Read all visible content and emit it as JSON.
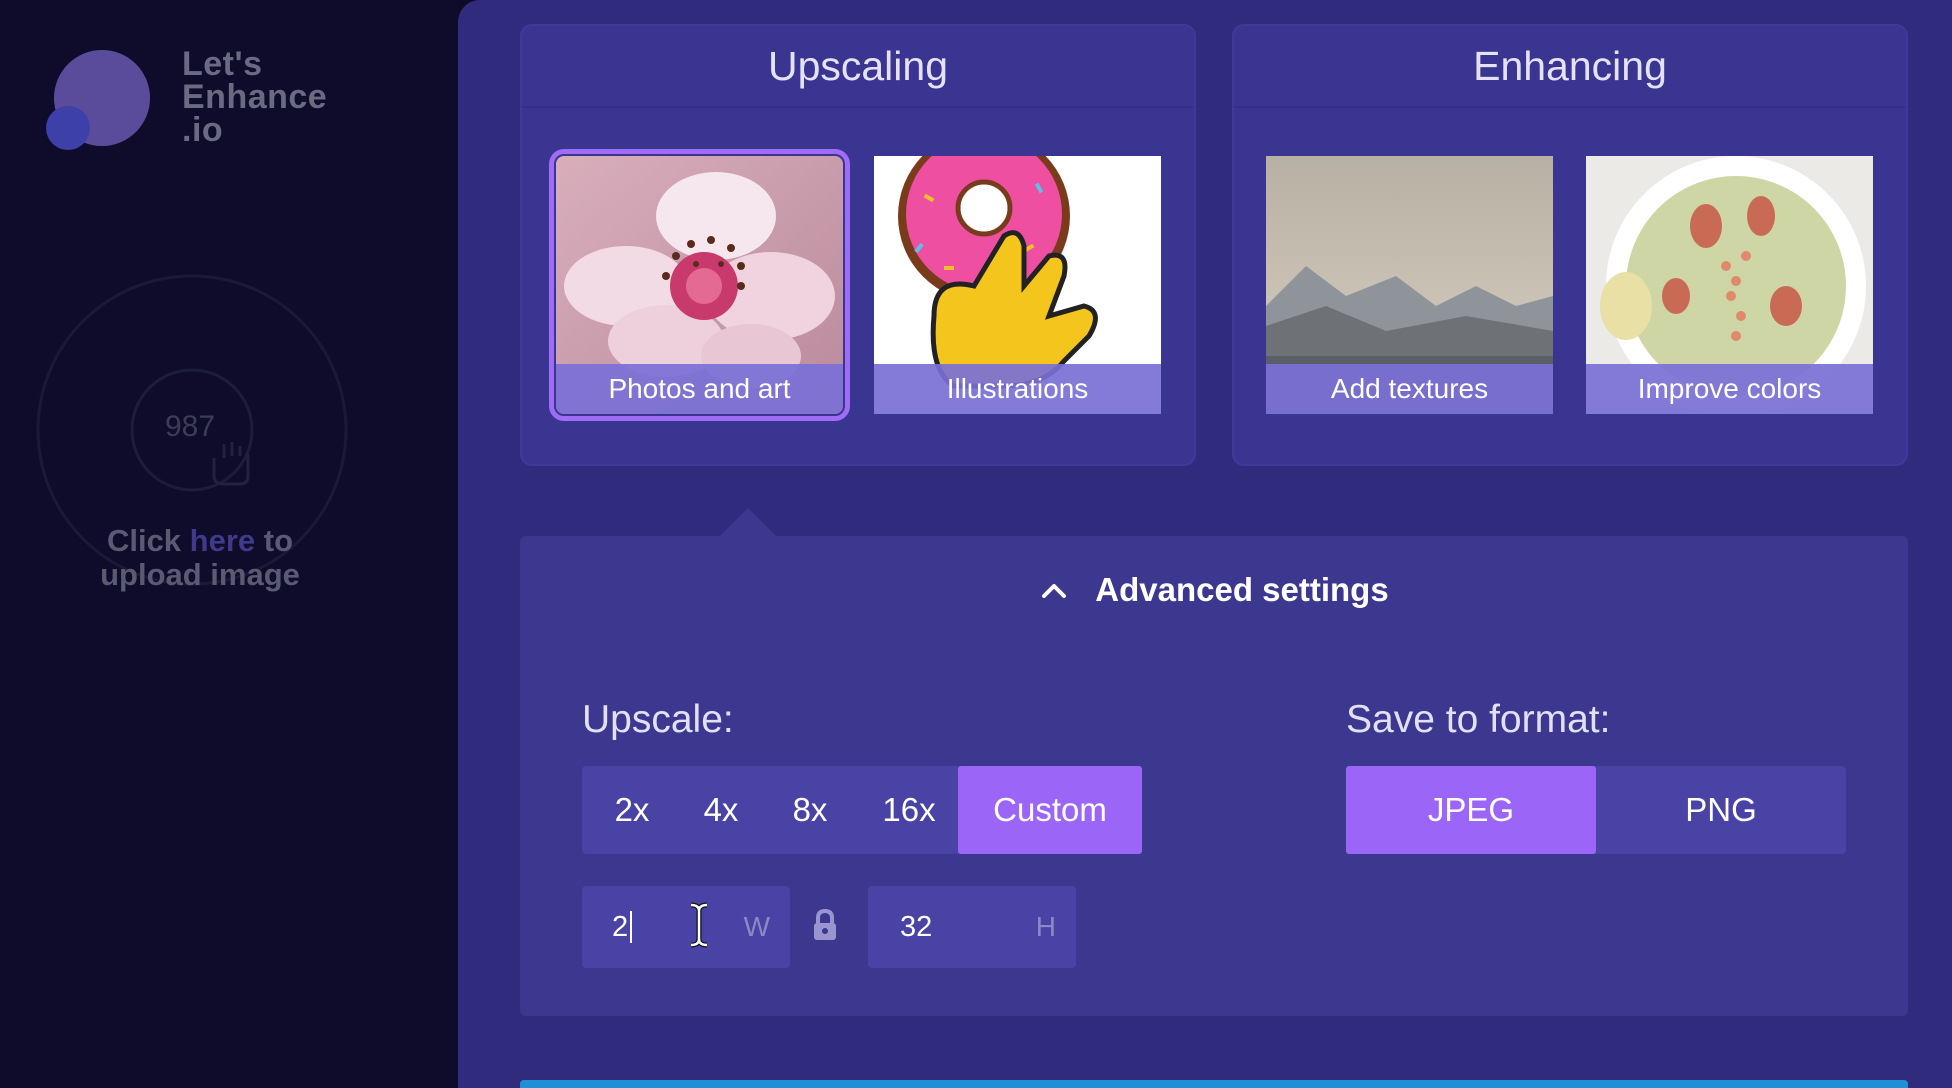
{
  "app": {
    "logo_lines": [
      "Let's",
      "Enhance",
      ".io"
    ],
    "logo_icon": "logo-icon"
  },
  "uploader": {
    "count": "987",
    "text_before": "Click ",
    "link_text": "here",
    "text_after": " to",
    "text_line2": "upload image",
    "icon": "hand-icon"
  },
  "upscaling": {
    "title": "Upscaling",
    "tiles": [
      {
        "label": "Photos and art",
        "selected": true
      },
      {
        "label": "Illustrations",
        "selected": false
      }
    ]
  },
  "enhancing": {
    "title": "Enhancing",
    "tiles": [
      {
        "label": "Add textures",
        "selected": false
      },
      {
        "label": "Improve colors",
        "selected": false
      }
    ]
  },
  "advanced": {
    "title": "Advanced settings",
    "upscale_label": "Upscale:",
    "upscale_options": [
      "2x",
      "4x",
      "8x",
      "16x",
      "Custom"
    ],
    "upscale_selected": "Custom",
    "format_label": "Save to format:",
    "format_options": [
      "JPEG",
      "PNG"
    ],
    "format_selected": "JPEG",
    "width_value": "2",
    "width_unit": "W",
    "height_value": "32",
    "height_unit": "H"
  },
  "colors": {
    "accent": "#9b66f7",
    "panel": "#302b7d",
    "sidebar": "#0e0c2a",
    "bottom_bar": "#1f8fd6"
  }
}
